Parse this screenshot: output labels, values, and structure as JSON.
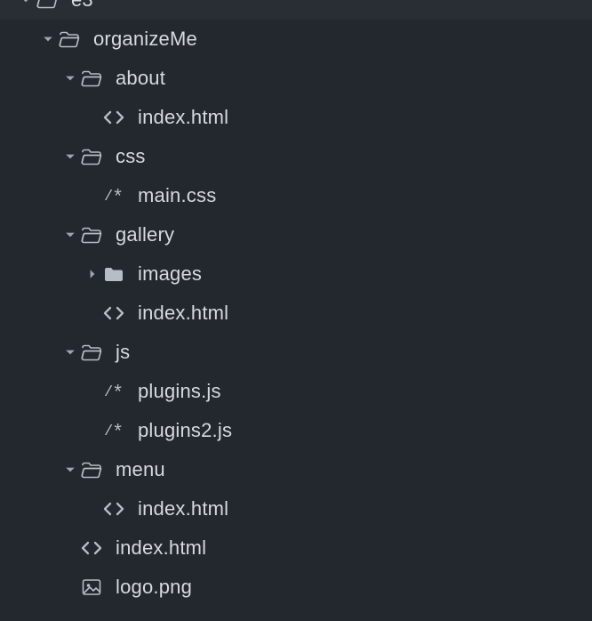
{
  "status": {
    "modified": true
  },
  "tree": {
    "name": "e3",
    "expanded": true,
    "kind": "folder-open",
    "children": [
      {
        "name": "organizeMe",
        "expanded": true,
        "kind": "folder-open",
        "children": [
          {
            "name": "about",
            "expanded": true,
            "kind": "folder-open",
            "children": [
              {
                "name": "index.html",
                "kind": "html"
              }
            ]
          },
          {
            "name": "css",
            "expanded": true,
            "kind": "folder-open",
            "children": [
              {
                "name": "main.css",
                "kind": "code"
              }
            ]
          },
          {
            "name": "gallery",
            "expanded": true,
            "kind": "folder-open",
            "children": [
              {
                "name": "images",
                "expanded": false,
                "kind": "folder-closed",
                "children": []
              },
              {
                "name": "index.html",
                "kind": "html"
              }
            ]
          },
          {
            "name": "js",
            "expanded": true,
            "kind": "folder-open",
            "children": [
              {
                "name": "plugins.js",
                "kind": "code"
              },
              {
                "name": "plugins2.js",
                "kind": "code"
              }
            ]
          },
          {
            "name": "menu",
            "expanded": true,
            "kind": "folder-open",
            "children": [
              {
                "name": "index.html",
                "kind": "html"
              }
            ]
          },
          {
            "name": "index.html",
            "kind": "html"
          },
          {
            "name": "logo.png",
            "kind": "image"
          }
        ]
      }
    ]
  }
}
